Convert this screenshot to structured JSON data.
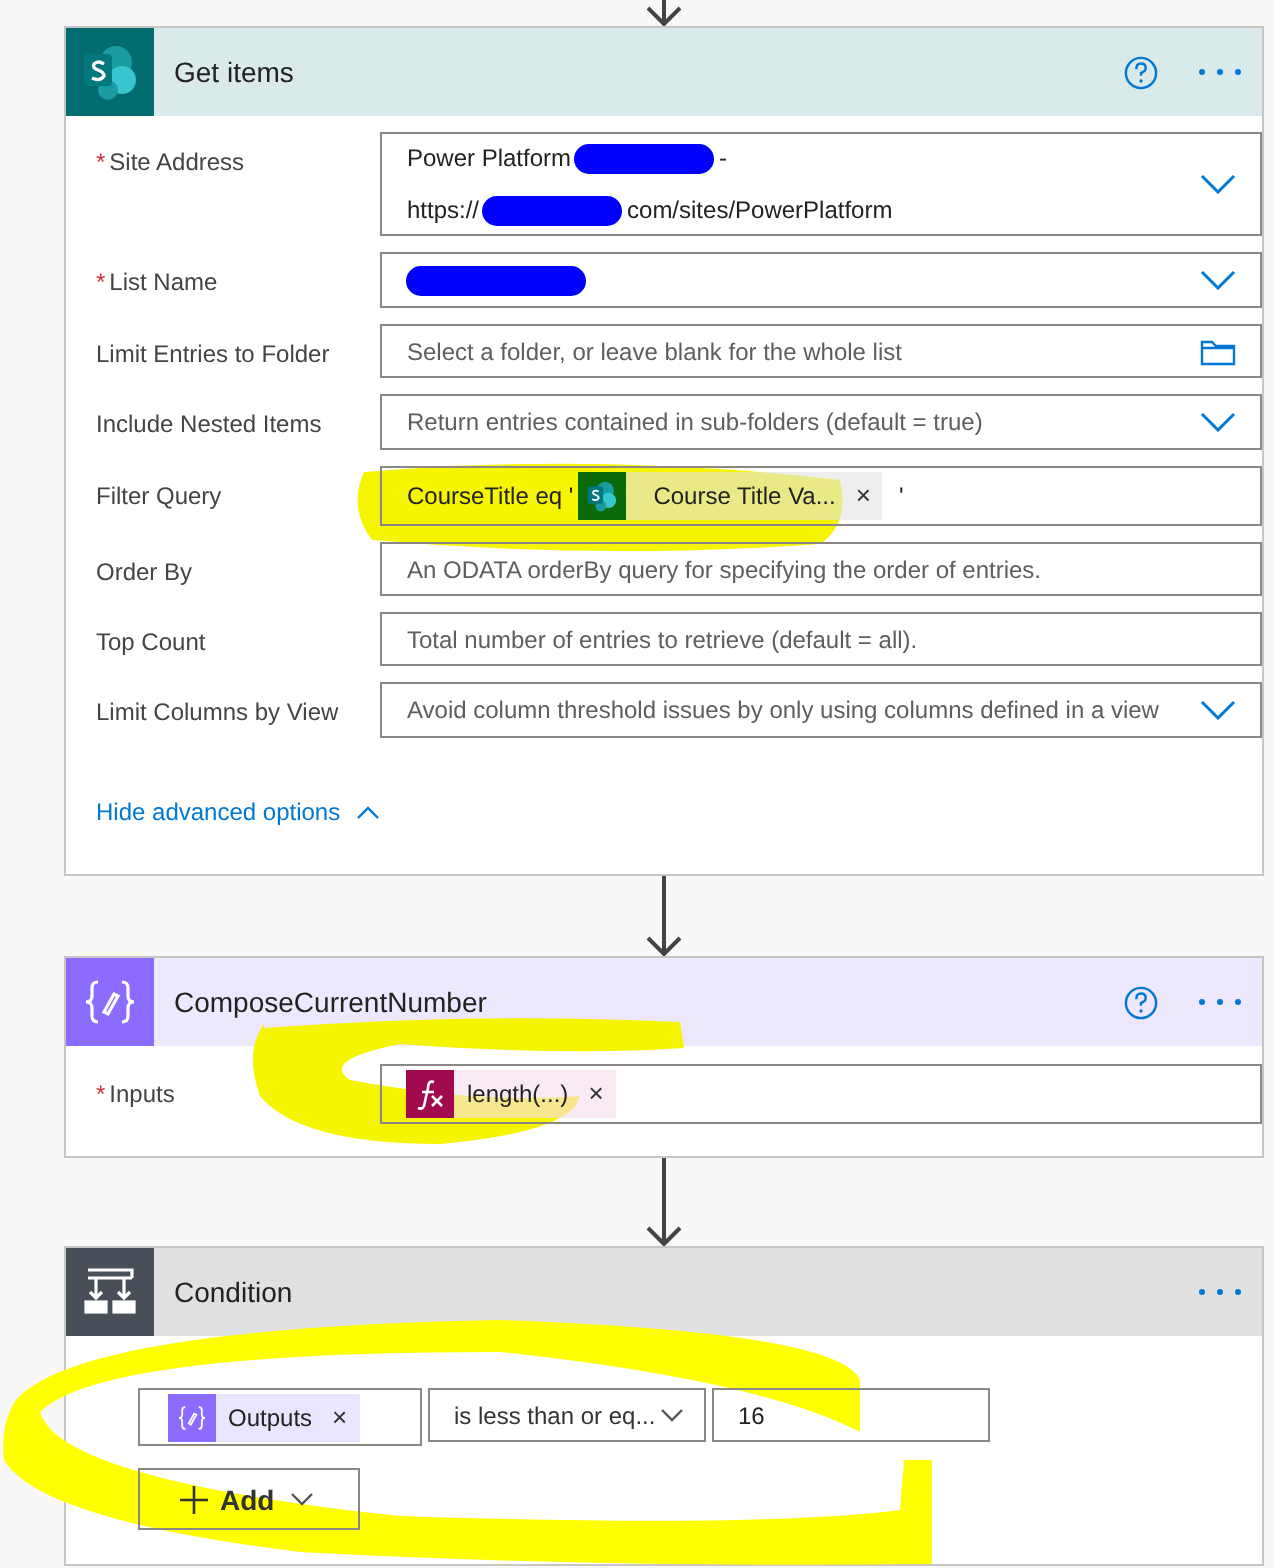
{
  "get_items": {
    "title": "Get items",
    "help": true,
    "fields": [
      {
        "label": "Site Address",
        "marker": "*",
        "kind": "site",
        "lines": [
          {
            "before": "Power Platform",
            "redacted": true,
            "after": "-"
          },
          {
            "before": "https://",
            "redacted": true,
            "after": "com/sites/PowerPlatform"
          }
        ]
      },
      {
        "label": "List Name",
        "marker": "*",
        "kind": "select",
        "redacted": true
      },
      {
        "label": "Limit Entries to Folder",
        "kind": "folder",
        "placeholder": "Select a folder, or leave blank for the whole list"
      },
      {
        "label": "Include Nested Items",
        "kind": "select",
        "placeholder": "Return entries contained in sub-folders (default = true)"
      },
      {
        "label": "Filter Query",
        "kind": "expression",
        "prefix": "CourseTitle eq '",
        "token": {
          "kind": "dynamic",
          "label": "Course Title Va...",
          "remove": "×"
        },
        "suffix": "'"
      },
      {
        "label": "Order By",
        "kind": "text",
        "placeholder": "An ODATA orderBy query for specifying the order of entries."
      },
      {
        "label": "Top Count",
        "kind": "text",
        "placeholder": "Total number of entries to retrieve (default = all)."
      },
      {
        "label": "Limit Columns by View",
        "kind": "select",
        "placeholder": "Avoid column threshold issues by only using columns defined in a view"
      }
    ],
    "advanced_toggle": {
      "label": "Hide advanced options",
      "expanded": true
    }
  },
  "compose": {
    "title": "ComposeCurrentNumber",
    "help": true,
    "fields": [
      {
        "label": "Inputs",
        "marker": "*",
        "kind": "expression",
        "token": {
          "kind": "function",
          "label": "length(...)",
          "remove": "×"
        }
      }
    ]
  },
  "condition": {
    "title": "Condition",
    "help": false,
    "row": {
      "operand": {
        "kind": "output",
        "label": "Outputs",
        "remove": "×"
      },
      "operator": "is less than or eq...",
      "value": "16"
    },
    "add_button": "Add"
  }
}
